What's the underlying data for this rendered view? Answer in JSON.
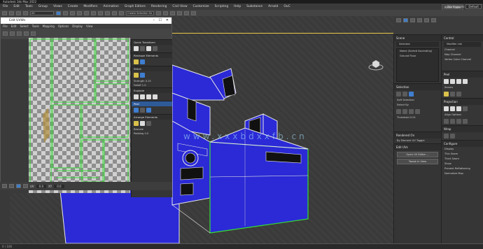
{
  "window": {
    "title": "Autodesk 3ds Max 2022"
  },
  "menubar": {
    "items": [
      "File",
      "Edit",
      "Tools",
      "Group",
      "Views",
      "Create",
      "Modifiers",
      "Animation",
      "Graph Editors",
      "Rendering",
      "Civil View",
      "Customize",
      "Scripting",
      "Help",
      "Substance",
      "Arnold",
      "OuC"
    ],
    "signin": "Alexis Cabo",
    "workspaces_label": "Workspaces:",
    "workspace": "Default"
  },
  "toolbar": {
    "selection_set": "Create Selection Se",
    "filter": "All"
  },
  "uv_editor": {
    "title": "Edit UVWs",
    "menu": [
      "File",
      "Edit",
      "Select",
      "Tools",
      "Mapping",
      "Options",
      "Display",
      "View"
    ],
    "sections": {
      "quick_transform": "Quick Transform",
      "reshape": "Reshape Elements",
      "stitch": "Stitch",
      "explode": "Explode",
      "peel": "Peel",
      "arrange": "Arrange Elements"
    },
    "labels": {
      "strength": "Strength",
      "strength_value": "0.15",
      "falloff": "Falloff",
      "falloff_value": "1.0",
      "rescale": "Rescale",
      "padding": "Padding",
      "padding_value": "0.0",
      "uv_field": "UV",
      "uv_value": "0.0",
      "xy_label": "XY",
      "zoom_value": "0.0"
    }
  },
  "scene_panel": {
    "title": "Scene",
    "filter": "Selected",
    "tree": [
      "Name (Sorted Ascending)",
      "Ground Floor"
    ],
    "sections": {
      "selection": "Selection",
      "soft_selection": "Soft Selection",
      "rendered_on": "Rendered On",
      "edit_uvs": "Edit UVs",
      "by_element": "By Element UV Toggle",
      "select_by": "Select By",
      "threshold": "Threshold",
      "threshold_value": "0.01",
      "edit_uv_btn": "Open UV Editor ...",
      "tweak_btn": "Tweak In View"
    }
  },
  "command_panel": {
    "title": "Control",
    "modifier_list": "Modifier List",
    "object_name": "Channel",
    "channel": "Map Channel",
    "vertex_color": "Vertex Color Channel",
    "sections": {
      "peel": "Peel",
      "seams": "Seams",
      "projection": "Projection",
      "align": "Align Options",
      "wrap": "Wrap",
      "configure": "Configure",
      "display": "Display",
      "thin_seam": "Thin Seam",
      "thick_seam": "Thick Seam",
      "show": "Show",
      "prevent": "Prevent Reflattening",
      "normalize": "Normalize Map"
    }
  },
  "status": {
    "text": "0 / 100"
  },
  "watermark": "www.xxxbdxxfb.cn",
  "colors": {
    "model_blue": "#2b2ad6",
    "edge_white": "#e8e8e8",
    "selection_yellow": "#e7c84a",
    "uv_green": "#33dd33",
    "accent_blue": "#3f7ed0"
  },
  "icons": [
    "close-icon",
    "maximize-icon",
    "minimize-icon",
    "navigation-cube-icon",
    "move-icon",
    "rotate-icon",
    "scale-icon"
  ]
}
